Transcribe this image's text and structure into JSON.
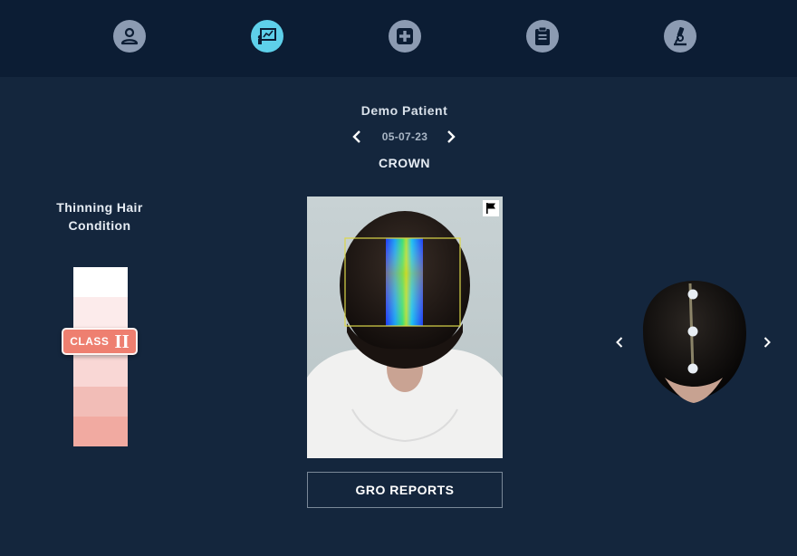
{
  "nav": {
    "items": [
      {
        "icon": "user-icon",
        "active": false
      },
      {
        "icon": "presentation-chart-icon",
        "active": true
      },
      {
        "icon": "medical-plus-icon",
        "active": false
      },
      {
        "icon": "clipboard-icon",
        "active": false
      },
      {
        "icon": "microscope-icon",
        "active": false
      }
    ]
  },
  "patient": {
    "name": "Demo Patient",
    "date": "05-07-23",
    "view": "CROWN"
  },
  "condition": {
    "title": "Thinning Hair Condition",
    "class_label": "CLASS",
    "class_value": "II",
    "scale_colors": [
      "#ffffff",
      "#fcebeb",
      "#fbe4e4",
      "#f9d7d5",
      "#f2bdb7",
      "#f1aaa1"
    ]
  },
  "image": {
    "flag_icon": "flag-icon"
  },
  "actions": {
    "reports_label": "GRO REPORTS"
  },
  "model": {
    "prev_icon": "chevron-left-icon",
    "next_icon": "chevron-right-icon",
    "markers": 3
  },
  "colors": {
    "background": "#14263d",
    "topbar": "#0c1d34",
    "nav_icon": "#8c9bb2",
    "nav_icon_active": "#5ed0ea",
    "class_badge": "#ee7f70"
  }
}
